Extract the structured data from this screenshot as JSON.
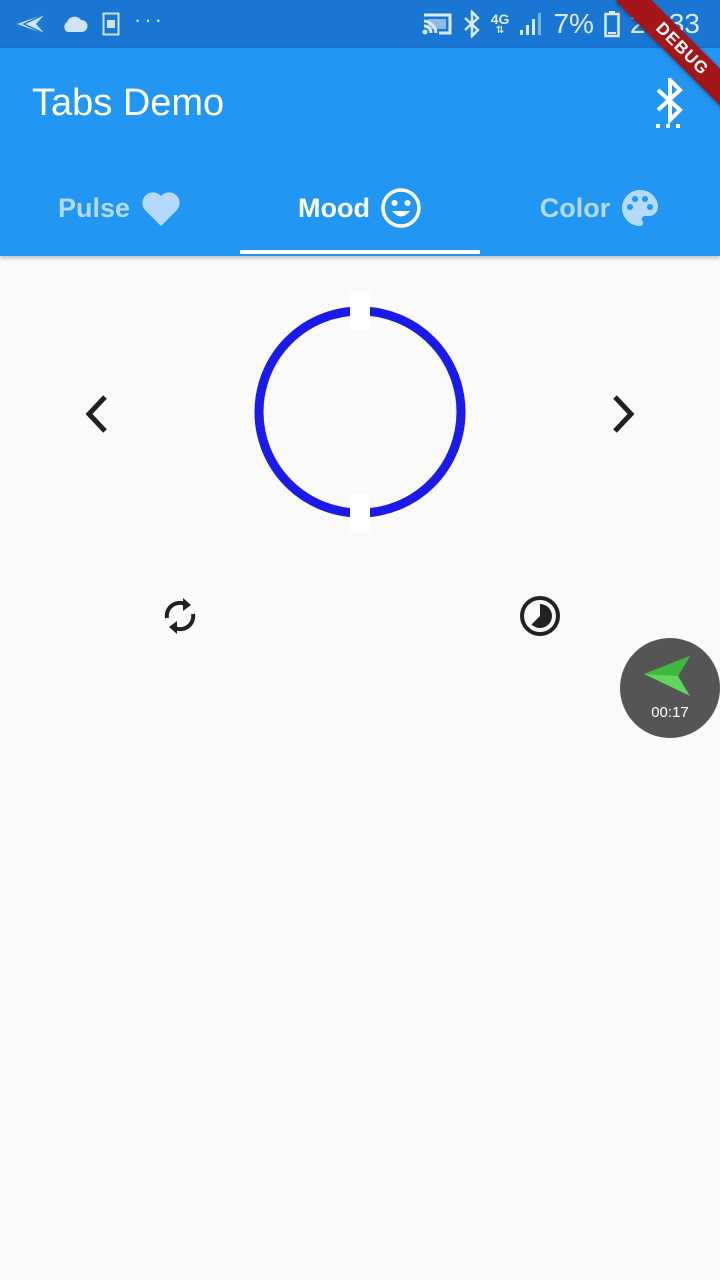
{
  "status_bar": {
    "network": "4G",
    "battery": "7%",
    "time": "20:33"
  },
  "app_bar": {
    "title": "Tabs Demo",
    "action_icon": "bluetooth-searching-icon"
  },
  "tabs": [
    {
      "label": "Pulse",
      "icon": "heart-icon",
      "active": false
    },
    {
      "label": "Mood",
      "icon": "smiley-icon",
      "active": true
    },
    {
      "label": "Color",
      "icon": "palette-icon",
      "active": false
    }
  ],
  "content": {
    "prev_icon": "chevron-left-icon",
    "next_icon": "chevron-right-icon",
    "refresh_icon": "refresh-icon",
    "timelapse_icon": "timelapse-icon",
    "circle_color": "#1a1aeb"
  },
  "recorder": {
    "time": "00:17"
  },
  "debug_banner": "DEBUG",
  "colors": {
    "status_bar": "#1976d2",
    "app_bar": "#2196f3",
    "inactive_tab": "#b3dafb",
    "background": "#fafafa"
  }
}
